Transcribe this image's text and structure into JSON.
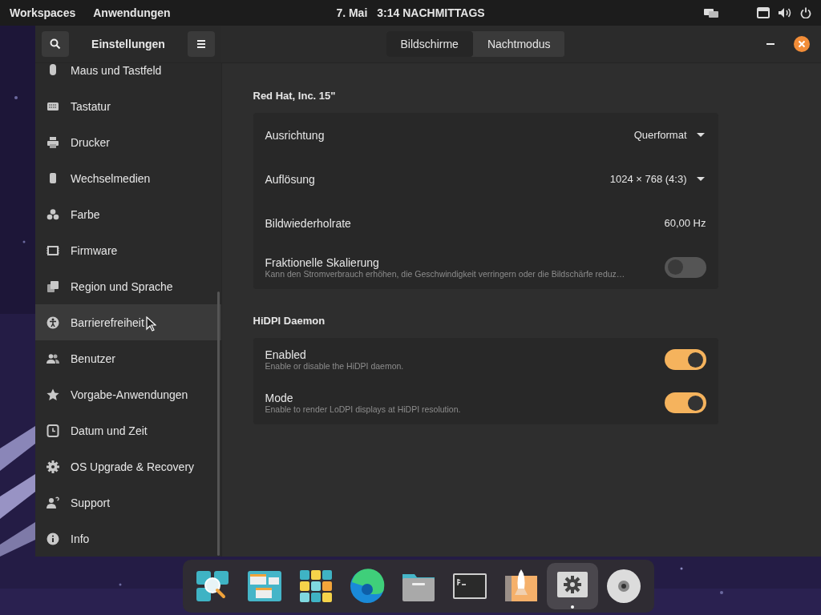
{
  "top_bar": {
    "left": [
      "Workspaces",
      "Anwendungen"
    ],
    "date": "7. Mai",
    "time": "3:14 NACHMITTAGS"
  },
  "window": {
    "title": "Einstellungen"
  },
  "tabs": [
    {
      "label": "Bildschirme",
      "selected": true
    },
    {
      "label": "Nachtmodus",
      "selected": false
    }
  ],
  "sidebar": {
    "items": [
      {
        "label": "Maus und Tastfeld",
        "kind": "mouse",
        "hovered": false
      },
      {
        "label": "Tastatur",
        "kind": "keyboard",
        "hovered": false
      },
      {
        "label": "Drucker",
        "kind": "printer",
        "hovered": false
      },
      {
        "label": "Wechselmedien",
        "kind": "drive",
        "hovered": false
      },
      {
        "label": "Farbe",
        "kind": "color",
        "hovered": false
      },
      {
        "label": "Firmware",
        "kind": "chip",
        "hovered": false
      },
      {
        "label": "Region und Sprache",
        "kind": "language",
        "hovered": false
      },
      {
        "label": "Barrierefreiheit",
        "kind": "accessibility",
        "hovered": true
      },
      {
        "label": "Benutzer",
        "kind": "users",
        "hovered": false
      },
      {
        "label": "Vorgabe-Anwendungen",
        "kind": "star",
        "hovered": false
      },
      {
        "label": "Datum und Zeit",
        "kind": "clock",
        "hovered": false
      },
      {
        "label": "OS Upgrade & Recovery",
        "kind": "gear",
        "hovered": false
      },
      {
        "label": "Support",
        "kind": "support",
        "hovered": false
      },
      {
        "label": "Info",
        "kind": "info",
        "hovered": false
      }
    ]
  },
  "sections": [
    {
      "title": "Red Hat, Inc. 15\"",
      "rows": [
        {
          "kind": "dropdown",
          "label": "Ausrichtung",
          "value": "Querformat"
        },
        {
          "kind": "dropdown",
          "label": "Auflösung",
          "value": "1024 × 768 (4:3)"
        },
        {
          "kind": "value",
          "label": "Bildwiederholrate",
          "value": "60,00 Hz"
        },
        {
          "kind": "switch",
          "label": "Fraktionelle Skalierung",
          "description": "Kann den Stromverbrauch erhöhen, die Geschwindigkeit verringern oder die Bildschärfe reduz…",
          "on": false
        }
      ]
    },
    {
      "title": "HiDPI Daemon",
      "rows": [
        {
          "kind": "switch",
          "label": "Enabled",
          "description": "Enable or disable the HiDPI daemon.",
          "on": true
        },
        {
          "kind": "switch",
          "label": "Mode",
          "description": "Enable to render LoDPI displays at HiDPI resolution.",
          "on": true
        }
      ]
    }
  ],
  "dock": [
    {
      "kind": "search",
      "running": false
    },
    {
      "kind": "workspaces",
      "running": false
    },
    {
      "kind": "apps",
      "running": false
    },
    {
      "kind": "browser",
      "running": false
    },
    {
      "kind": "files",
      "running": false
    },
    {
      "kind": "terminal",
      "running": false
    },
    {
      "kind": "launcher",
      "running": false
    },
    {
      "kind": "settings",
      "running": true
    },
    {
      "kind": "disc",
      "running": false
    }
  ]
}
